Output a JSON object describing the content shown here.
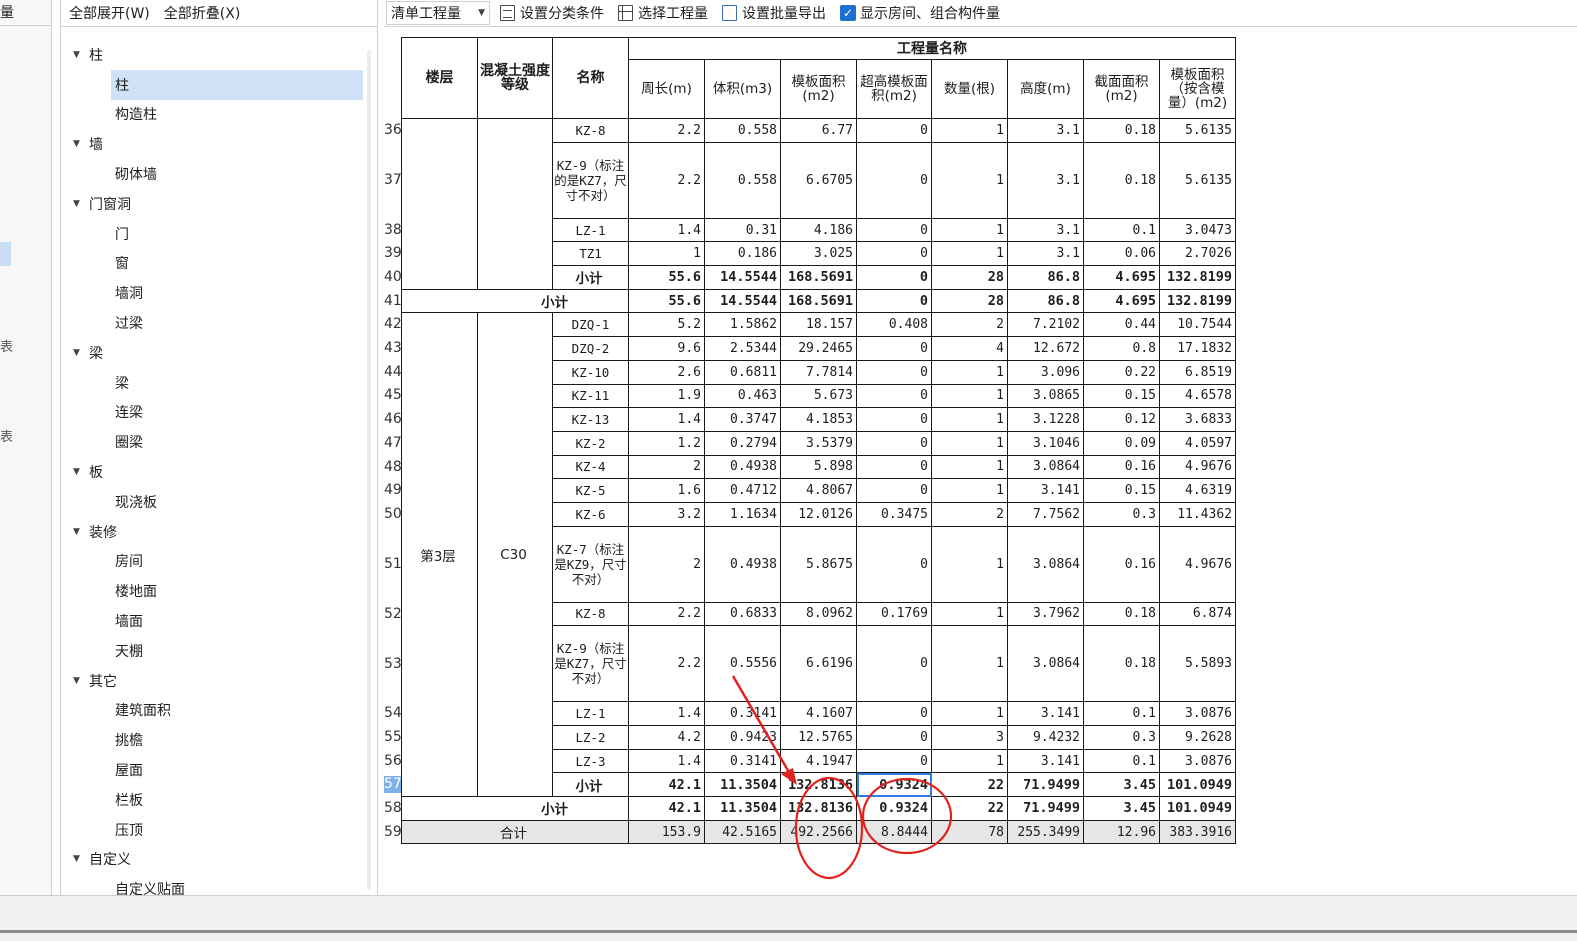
{
  "left_panel": {
    "cut_title": "量",
    "cut_label_a": "表",
    "cut_label_b": "表"
  },
  "tree_toolbar": {
    "expand_all": "全部展开(W)",
    "collapse_all": "全部折叠(X)"
  },
  "tree": [
    {
      "type": "cat",
      "label": "柱"
    },
    {
      "type": "leaf",
      "label": "柱",
      "selected": true
    },
    {
      "type": "leaf",
      "label": "构造柱"
    },
    {
      "type": "cat",
      "label": "墙"
    },
    {
      "type": "leaf",
      "label": "砌体墙"
    },
    {
      "type": "cat",
      "label": "门窗洞"
    },
    {
      "type": "leaf",
      "label": "门"
    },
    {
      "type": "leaf",
      "label": "窗"
    },
    {
      "type": "leaf",
      "label": "墙洞"
    },
    {
      "type": "leaf",
      "label": "过梁"
    },
    {
      "type": "cat",
      "label": "梁"
    },
    {
      "type": "leaf",
      "label": "梁"
    },
    {
      "type": "leaf",
      "label": "连梁"
    },
    {
      "type": "leaf",
      "label": "圈梁"
    },
    {
      "type": "cat",
      "label": "板"
    },
    {
      "type": "leaf",
      "label": "现浇板"
    },
    {
      "type": "cat",
      "label": "装修"
    },
    {
      "type": "leaf",
      "label": "房间"
    },
    {
      "type": "leaf",
      "label": "楼地面"
    },
    {
      "type": "leaf",
      "label": "墙面"
    },
    {
      "type": "leaf",
      "label": "天棚"
    },
    {
      "type": "cat",
      "label": "其它"
    },
    {
      "type": "leaf",
      "label": "建筑面积"
    },
    {
      "type": "leaf",
      "label": "挑檐"
    },
    {
      "type": "leaf",
      "label": "屋面"
    },
    {
      "type": "leaf",
      "label": "栏板"
    },
    {
      "type": "leaf",
      "label": "压顶"
    },
    {
      "type": "cat",
      "label": "自定义"
    },
    {
      "type": "leaf",
      "label": "自定义贴面"
    }
  ],
  "toolbar": {
    "quantity_select": "清单工程量",
    "set_category": "设置分类条件",
    "select_quantity": "选择工程量",
    "batch_export": "设置批量导出",
    "show_rooms_label": "显示房间、组合构件量",
    "show_rooms_checked": true
  },
  "table": {
    "header_group": "工程量名称",
    "columns": {
      "floor": "楼层",
      "grade": "混凝土强度等级",
      "name": "名称",
      "perimeter": "周长(m)",
      "volume": "体积(m3)",
      "formwork": "模板面积(m2)",
      "over_height": "超高模板面积(m2)",
      "count": "数量(根)",
      "height": "高度(m)",
      "section": "截面面积(m2)",
      "formwork_model": "模板面积（按含模量）(m2)"
    },
    "floor_label": "第3层",
    "grade_label": "C30",
    "subtotal_label": "小计",
    "total_label": "合计",
    "active_row": "57",
    "rows": [
      {
        "n": "36",
        "name": "KZ-8",
        "v": [
          "2.2",
          "0.558",
          "6.77",
          "0",
          "1",
          "3.1",
          "0.18",
          "5.6135"
        ]
      },
      {
        "n": "37",
        "name": "KZ-9（标注的是KZ7，尺寸不对）",
        "v": [
          "2.2",
          "0.558",
          "6.6705",
          "0",
          "1",
          "3.1",
          "0.18",
          "5.6135"
        ]
      },
      {
        "n": "38",
        "name": "LZ-1",
        "v": [
          "1.4",
          "0.31",
          "4.186",
          "0",
          "1",
          "3.1",
          "0.1",
          "3.0473"
        ]
      },
      {
        "n": "39",
        "name": "TZ1",
        "v": [
          "1",
          "0.186",
          "3.025",
          "0",
          "1",
          "3.1",
          "0.06",
          "2.7026"
        ]
      },
      {
        "n": "40",
        "name": "小计",
        "v": [
          "55.6",
          "14.5544",
          "168.5691",
          "0",
          "28",
          "86.8",
          "4.695",
          "132.8199"
        ]
      },
      {
        "n": "41",
        "name": "小计",
        "v": [
          "55.6",
          "14.5544",
          "168.5691",
          "0",
          "28",
          "86.8",
          "4.695",
          "132.8199"
        ]
      },
      {
        "n": "42",
        "name": "DZQ-1",
        "v": [
          "5.2",
          "1.5862",
          "18.157",
          "0.408",
          "2",
          "7.2102",
          "0.44",
          "10.7544"
        ]
      },
      {
        "n": "43",
        "name": "DZQ-2",
        "v": [
          "9.6",
          "2.5344",
          "29.2465",
          "0",
          "4",
          "12.672",
          "0.8",
          "17.1832"
        ]
      },
      {
        "n": "44",
        "name": "KZ-10",
        "v": [
          "2.6",
          "0.6811",
          "7.7814",
          "0",
          "1",
          "3.096",
          "0.22",
          "6.8519"
        ]
      },
      {
        "n": "45",
        "name": "KZ-11",
        "v": [
          "1.9",
          "0.463",
          "5.673",
          "0",
          "1",
          "3.0865",
          "0.15",
          "4.6578"
        ]
      },
      {
        "n": "46",
        "name": "KZ-13",
        "v": [
          "1.4",
          "0.3747",
          "4.1853",
          "0",
          "1",
          "3.1228",
          "0.12",
          "3.6833"
        ]
      },
      {
        "n": "47",
        "name": "KZ-2",
        "v": [
          "1.2",
          "0.2794",
          "3.5379",
          "0",
          "1",
          "3.1046",
          "0.09",
          "4.0597"
        ]
      },
      {
        "n": "48",
        "name": "KZ-4",
        "v": [
          "2",
          "0.4938",
          "5.898",
          "0",
          "1",
          "3.0864",
          "0.16",
          "4.9676"
        ]
      },
      {
        "n": "49",
        "name": "KZ-5",
        "v": [
          "1.6",
          "0.4712",
          "4.8067",
          "0",
          "1",
          "3.141",
          "0.15",
          "4.6319"
        ]
      },
      {
        "n": "50",
        "name": "KZ-6",
        "v": [
          "3.2",
          "1.1634",
          "12.0126",
          "0.3475",
          "2",
          "7.7562",
          "0.3",
          "11.4362"
        ]
      },
      {
        "n": "51",
        "name": "KZ-7（标注是KZ9，尺寸不对）",
        "v": [
          "2",
          "0.4938",
          "5.8675",
          "0",
          "1",
          "3.0864",
          "0.16",
          "4.9676"
        ]
      },
      {
        "n": "52",
        "name": "KZ-8",
        "v": [
          "2.2",
          "0.6833",
          "8.0962",
          "0.1769",
          "1",
          "3.7962",
          "0.18",
          "6.874"
        ]
      },
      {
        "n": "53",
        "name": "KZ-9（标注是KZ7，尺寸不对）",
        "v": [
          "2.2",
          "0.5556",
          "6.6196",
          "0",
          "1",
          "3.0864",
          "0.18",
          "5.5893"
        ]
      },
      {
        "n": "54",
        "name": "LZ-1",
        "v": [
          "1.4",
          "0.3141",
          "4.1607",
          "0",
          "1",
          "3.141",
          "0.1",
          "3.0876"
        ]
      },
      {
        "n": "55",
        "name": "LZ-2",
        "v": [
          "4.2",
          "0.9423",
          "12.5765",
          "0",
          "3",
          "9.4232",
          "0.3",
          "9.2628"
        ]
      },
      {
        "n": "56",
        "name": "LZ-3",
        "v": [
          "1.4",
          "0.3141",
          "4.1947",
          "0",
          "1",
          "3.141",
          "0.1",
          "3.0876"
        ]
      },
      {
        "n": "57",
        "name": "小计",
        "v": [
          "42.1",
          "11.3504",
          "132.8136",
          "0.9324",
          "22",
          "71.9499",
          "3.45",
          "101.0949"
        ]
      },
      {
        "n": "58",
        "name": "小计",
        "v": [
          "42.1",
          "11.3504",
          "132.8136",
          "0.9324",
          "22",
          "71.9499",
          "3.45",
          "101.0949"
        ]
      },
      {
        "n": "59",
        "name": "合计",
        "v": [
          "153.9",
          "42.5165",
          "492.2566",
          "8.8444",
          "78",
          "255.3499",
          "12.96",
          "383.3916"
        ]
      }
    ]
  },
  "annotation_color": "#e0231e"
}
